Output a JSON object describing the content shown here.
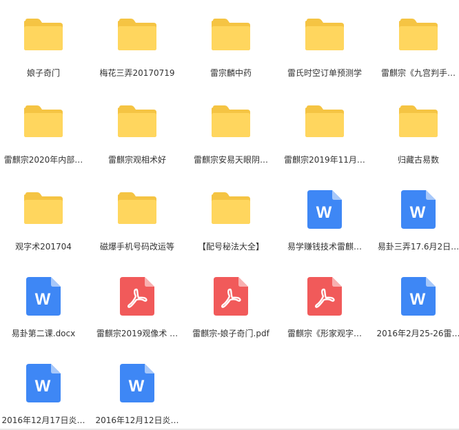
{
  "colors": {
    "folder_back": "#F5C443",
    "folder_front": "#FFD65E",
    "word": "#3E87F5",
    "word_fold": "#A7C8FA",
    "pdf": "#F15A5A",
    "pdf_fold": "#F8B0B0",
    "label": "#333333"
  },
  "files": [
    {
      "name": "娘子奇门",
      "type": "folder",
      "icon": "folder-icon"
    },
    {
      "name": "梅花三弄20170719",
      "type": "folder",
      "icon": "folder-icon"
    },
    {
      "name": "雷宗麟中药",
      "type": "folder",
      "icon": "folder-icon"
    },
    {
      "name": "雷氏时空订单预测学",
      "type": "folder",
      "icon": "folder-icon"
    },
    {
      "name": "雷麒宗《九宫判手…",
      "type": "folder",
      "icon": "folder-icon"
    },
    {
      "name": "雷麒宗2020年内部…",
      "type": "folder",
      "icon": "folder-icon"
    },
    {
      "name": "雷麒宗观相术好",
      "type": "folder",
      "icon": "folder-icon"
    },
    {
      "name": "雷麒宗安易天眼阴…",
      "type": "folder",
      "icon": "folder-icon"
    },
    {
      "name": "雷麒宗2019年11月…",
      "type": "folder",
      "icon": "folder-icon"
    },
    {
      "name": "归藏古易数",
      "type": "folder",
      "icon": "folder-icon"
    },
    {
      "name": "观字术201704",
      "type": "folder",
      "icon": "folder-icon"
    },
    {
      "name": "磁爆手机号码改运等",
      "type": "folder",
      "icon": "folder-icon"
    },
    {
      "name": "【配号秘法大全】",
      "type": "folder",
      "icon": "folder-icon"
    },
    {
      "name": "易学赚钱技术雷麒…",
      "type": "word",
      "icon": "word-icon",
      "glyph": "W"
    },
    {
      "name": "易卦三弄17.6月2日…",
      "type": "word",
      "icon": "word-icon",
      "glyph": "W"
    },
    {
      "name": "易卦第二课.docx",
      "type": "word",
      "icon": "word-icon",
      "glyph": "W"
    },
    {
      "name": "雷麒宗2019观像术 …",
      "type": "pdf",
      "icon": "pdf-icon"
    },
    {
      "name": "雷麒宗-娘子奇门.pdf",
      "type": "pdf",
      "icon": "pdf-icon"
    },
    {
      "name": "雷麒宗《形家观字…",
      "type": "pdf",
      "icon": "pdf-icon"
    },
    {
      "name": "2016年2月25-26雷…",
      "type": "word",
      "icon": "word-icon",
      "glyph": "W"
    },
    {
      "name": "2016年12月17日炎…",
      "type": "word",
      "icon": "word-icon",
      "glyph": "W"
    },
    {
      "name": "2016年12月12日炎…",
      "type": "word",
      "icon": "word-icon",
      "glyph": "W"
    }
  ]
}
